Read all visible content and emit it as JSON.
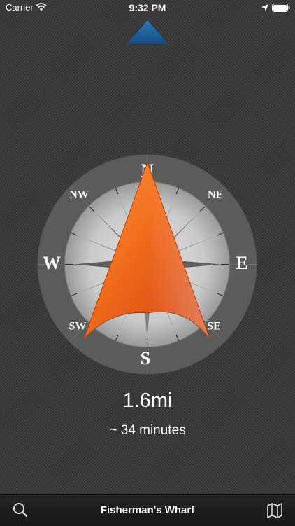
{
  "status_bar": {
    "carrier": "Carrier",
    "time": "9:32 PM"
  },
  "compass": {
    "cardinals": {
      "north": "N",
      "east": "E",
      "south": "S",
      "west": "W"
    },
    "intercardinals": {
      "northeast": "NE",
      "southeast": "SE",
      "southwest": "SW",
      "northwest": "NW"
    },
    "arrow_color": "#f06b1c"
  },
  "navigation": {
    "distance": "1.6mi",
    "eta": "~ 34 minutes"
  },
  "tab_bar": {
    "destination": "Fisherman's Wharf",
    "search_icon": "search-icon",
    "map_icon": "map-icon"
  },
  "colors": {
    "background": "#3a3a3a",
    "heading_indicator": "#1f5c94",
    "tab_bar": "#1c1c1c"
  }
}
